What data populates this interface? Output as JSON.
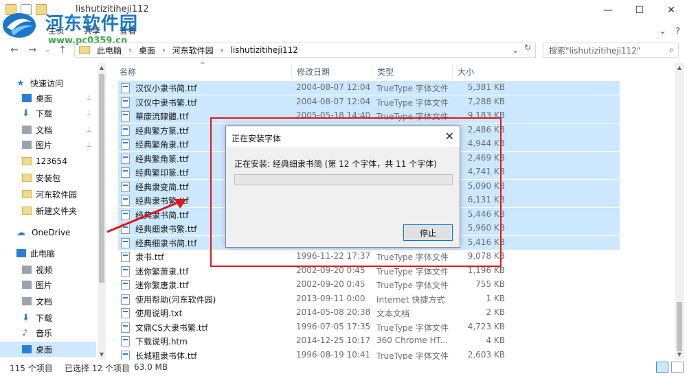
{
  "window": {
    "title": "lishutizitiheji112",
    "minimize": "—",
    "maximize": "☐",
    "close": "✕"
  },
  "watermark": {
    "site_name": "河东软件园",
    "url": "www.pc0359.cn"
  },
  "ribbon": {
    "tabs": [
      "文件",
      "主页",
      "共享",
      "查看"
    ],
    "expand": "⌄",
    "help": "?"
  },
  "address": {
    "crumbs": [
      "此电脑",
      "桌面",
      "河东软件园",
      "lishutizitiheji112"
    ],
    "search_placeholder": "搜索\"lishutizitiheji112\""
  },
  "nav": {
    "items": [
      {
        "label": "快速访问",
        "icon": "star-icon",
        "top": true
      },
      {
        "label": "桌面",
        "icon": "desktop-icon",
        "pinned": true
      },
      {
        "label": "下载",
        "icon": "download-icon",
        "pinned": true
      },
      {
        "label": "文档",
        "icon": "document-icon",
        "pinned": true
      },
      {
        "label": "图片",
        "icon": "pictures-icon",
        "pinned": true
      },
      {
        "label": "123654",
        "icon": "folder-icon"
      },
      {
        "label": "安装包",
        "icon": "folder-icon"
      },
      {
        "label": "河东软件园",
        "icon": "folder-icon"
      },
      {
        "label": "新建文件夹",
        "icon": "folder-icon"
      },
      {
        "label": "OneDrive",
        "icon": "cloud-icon",
        "top": true
      },
      {
        "label": "此电脑",
        "icon": "computer-icon",
        "top": true
      },
      {
        "label": "视频",
        "icon": "video-icon"
      },
      {
        "label": "图片",
        "icon": "pictures-icon"
      },
      {
        "label": "文档",
        "icon": "document-icon"
      },
      {
        "label": "下载",
        "icon": "download-icon"
      },
      {
        "label": "音乐",
        "icon": "music-icon"
      },
      {
        "label": "桌面",
        "icon": "desktop-icon",
        "selected": true
      }
    ]
  },
  "columns": [
    "名称",
    "修改日期",
    "类型",
    "大小"
  ],
  "files": [
    {
      "name": "汉仪小隶书简.ttf",
      "date": "2004-08-07 12:04",
      "type": "TrueType 字体文件",
      "size": "5,381 KB",
      "selected": true
    },
    {
      "name": "汉仪中隶书繁.ttf",
      "date": "2004-08-07 12:04",
      "type": "TrueType 字体文件",
      "size": "7,288 KB",
      "selected": true
    },
    {
      "name": "華康流隸體.ttf",
      "date": "2005-05-18 14:40",
      "type": "TrueType 字体文件",
      "size": "9,183 KB",
      "selected": true
    },
    {
      "name": "经典繁方篆.ttf",
      "date": "",
      "type": "",
      "size": "2,486 KB",
      "selected": true
    },
    {
      "name": "经典繁角隶.ttf",
      "date": "",
      "type": "",
      "size": "4,944 KB",
      "selected": true
    },
    {
      "name": "经典繁角篆.ttf",
      "date": "",
      "type": "",
      "size": "2,469 KB",
      "selected": true
    },
    {
      "name": "经典繁印篆.ttf",
      "date": "",
      "type": "",
      "size": "4,741 KB",
      "selected": true
    },
    {
      "name": "经典隶变简.ttf",
      "date": "",
      "type": "",
      "size": "5,090 KB",
      "selected": true
    },
    {
      "name": "经典隶书繁.ttf",
      "date": "",
      "type": "",
      "size": "6,131 KB",
      "selected": true
    },
    {
      "name": "经典隶书简.ttf",
      "date": "",
      "type": "",
      "size": "5,446 KB",
      "selected": true
    },
    {
      "name": "经典细隶书繁.ttf",
      "date": "",
      "type": "",
      "size": "5,960 KB",
      "selected": true
    },
    {
      "name": "经典细隶书简.ttf",
      "date": "",
      "type": "",
      "size": "5,416 KB",
      "selected": true
    },
    {
      "name": "隶书.ttf",
      "date": "1996-11-22 17:37",
      "type": "TrueType 字体文件",
      "size": "9,078 KB",
      "selected": false
    },
    {
      "name": "迷你繁萧隶.ttf",
      "date": "2002-09-20 0:45",
      "type": "TrueType 字体文件",
      "size": "1,196 KB",
      "selected": false
    },
    {
      "name": "迷你繁唐隶.ttf",
      "date": "2002-09-20 0:45",
      "type": "TrueType 字体文件",
      "size": "755 KB",
      "selected": false
    },
    {
      "name": "使用帮助(河东软件园)",
      "date": "2013-09-11 0:00",
      "type": "Internet 快捷方式",
      "size": "1 KB",
      "selected": false
    },
    {
      "name": "使用说明.txt",
      "date": "2014-05-08 20:38",
      "type": "文本文档",
      "size": "2 KB",
      "selected": false
    },
    {
      "name": "文鼎CS大隶书繁.ttf",
      "date": "1996-07-05 17:35",
      "type": "TrueType 字体文件",
      "size": "4,723 KB",
      "selected": false
    },
    {
      "name": "下载说明.htm",
      "date": "2014-12-25 10:17",
      "type": "360 Chrome HT...",
      "size": "4 KB",
      "selected": false
    },
    {
      "name": "长城粗隶书体.ttf",
      "date": "1996-08-19 10:41",
      "type": "TrueType 字体文件",
      "size": "2,603 KB",
      "selected": false
    }
  ],
  "dialog": {
    "title": "正在安装字体",
    "close": "✕",
    "status": "正在安装: 经典细隶书简 (第 12 个字体，共 11 个字体)",
    "progress": 0,
    "stop_label": "停止"
  },
  "status": {
    "count": "115 个项目",
    "selected": "已选择 12 个项目",
    "size": "63.0 MB"
  },
  "colors": {
    "selection": "#cce8ff",
    "highlight_box": "#e3151b",
    "accent": "#0078d7"
  }
}
